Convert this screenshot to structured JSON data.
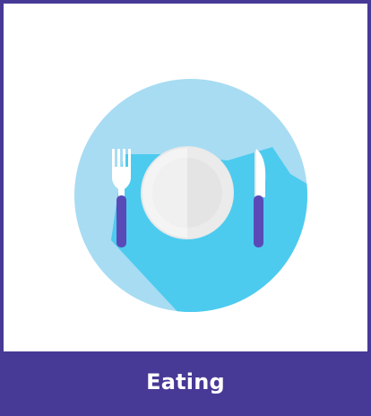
{
  "card": {
    "label": "Eating",
    "icon": "fork-plate-knife-icon"
  },
  "colors": {
    "border": "#473a96",
    "label_background": "#473a96",
    "label_text": "#ffffff",
    "circle": "#a7dcf3",
    "shadow": "#4ccbef",
    "plate_rim": "#f1f1f1",
    "plate_center": "#e2e2e2",
    "utensil_metal": "#ffffff",
    "utensil_handle": "#5a4ab8"
  }
}
